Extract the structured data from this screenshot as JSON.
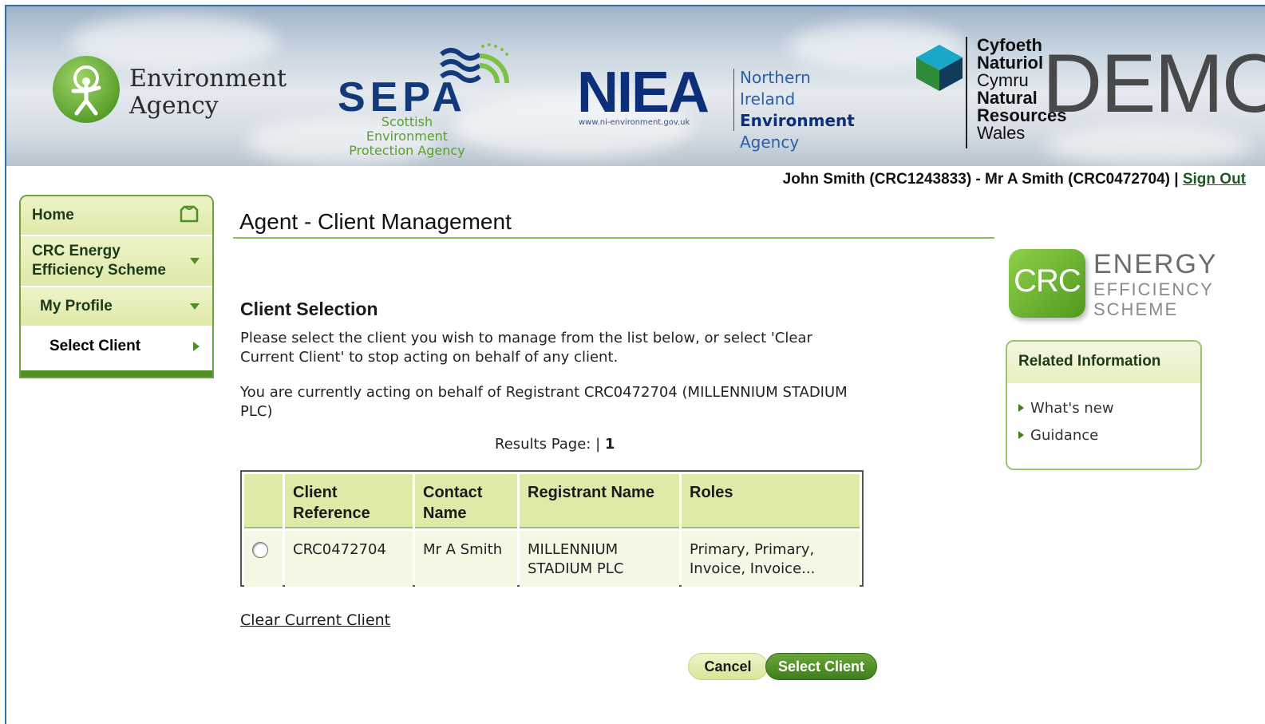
{
  "banner": {
    "logos": {
      "environment_agency": {
        "line1": "Environment",
        "line2": "Agency"
      },
      "sepa": {
        "word": "SEPA",
        "sub1": "Scottish Environment",
        "sub2": "Protection Agency"
      },
      "niea": {
        "word": "NIEA",
        "url": "www.ni-environment.gov.uk",
        "line1": "Northern Ireland",
        "line2": "Environment",
        "line3": "Agency"
      },
      "nrw": {
        "line1": "Cyfoeth",
        "line2": "Naturiol",
        "line3": "Cymru",
        "line4": "Natural",
        "line5": "Resources",
        "line6": "Wales"
      }
    },
    "watermark": "DEMO"
  },
  "userbar": {
    "identity": "John Smith (CRC1243833) - Mr A Smith (CRC0472704) | ",
    "sign_out": "Sign Out"
  },
  "nav": {
    "home": "Home",
    "crc": "CRC Energy Efficiency Scheme",
    "my_profile": "My Profile",
    "select_client": "Select Client"
  },
  "main": {
    "title": "Agent - Client Management",
    "section_title": "Client Selection",
    "instructions": "Please select the client you wish to manage from the list below, or select 'Clear Current Client' to stop acting on behalf of any client.",
    "current_status": "You are currently acting on behalf of Registrant CRC0472704 (MILLENNIUM STADIUM PLC)",
    "results_label": "Results Page: | ",
    "results_page": "1",
    "table": {
      "headers": [
        "",
        "Client Reference",
        "Contact Name",
        "Registrant Name",
        "Roles"
      ],
      "rows": [
        {
          "client_reference": "CRC0472704",
          "contact_name": "Mr A Smith",
          "registrant_name": "MILLENNIUM STADIUM PLC",
          "roles": "Primary, Primary, Invoice, Invoice...",
          "selected": false
        }
      ]
    },
    "clear_link": "Clear Current Client",
    "cancel_button": "Cancel",
    "select_button": "Select Client"
  },
  "sidebar": {
    "crc_logo": {
      "box": "CRC",
      "word1": "ENERGY",
      "word2": "EFFICIENCY",
      "word3": "SCHEME"
    },
    "related": {
      "title": "Related Information",
      "items": [
        "What's new",
        "Guidance"
      ]
    }
  },
  "icons": {
    "home": "home-icon",
    "dropdown": "chevron-down-icon",
    "arrow": "chevron-right-icon"
  },
  "colors": {
    "accent_green": "#4f8f23",
    "panel_green": "#dfe9a8",
    "nav_border": "#6da33f",
    "banner_navy": "#0d2f7a"
  }
}
